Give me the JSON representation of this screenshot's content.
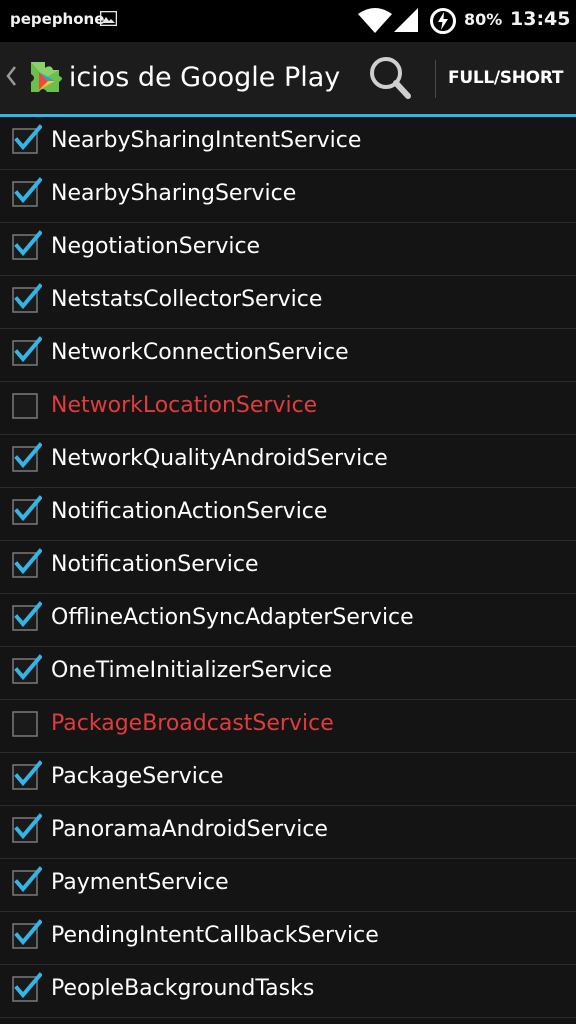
{
  "status_bar": {
    "carrier": "pepephone",
    "battery": "80%",
    "time": "13:45"
  },
  "action_bar": {
    "title": "Servicios de Google Play",
    "toggle_label": "FULL/SHORT"
  },
  "colors": {
    "accent": "#33b5e5",
    "disabled_text": "#e23b3b",
    "background": "#141414"
  },
  "services": [
    {
      "name": "NearbySharingIntentService",
      "enabled": true
    },
    {
      "name": "NearbySharingService",
      "enabled": true
    },
    {
      "name": "NegotiationService",
      "enabled": true
    },
    {
      "name": "NetstatsCollectorService",
      "enabled": true
    },
    {
      "name": "NetworkConnectionService",
      "enabled": true
    },
    {
      "name": "NetworkLocationService",
      "enabled": false
    },
    {
      "name": "NetworkQualityAndroidService",
      "enabled": true
    },
    {
      "name": "NotificationActionService",
      "enabled": true
    },
    {
      "name": "NotificationService",
      "enabled": true
    },
    {
      "name": "OfflineActionSyncAdapterService",
      "enabled": true
    },
    {
      "name": "OneTimeInitializerService",
      "enabled": true
    },
    {
      "name": "PackageBroadcastService",
      "enabled": false
    },
    {
      "name": "PackageService",
      "enabled": true
    },
    {
      "name": "PanoramaAndroidService",
      "enabled": true
    },
    {
      "name": "PaymentService",
      "enabled": true
    },
    {
      "name": "PendingIntentCallbackService",
      "enabled": true
    },
    {
      "name": "PeopleBackgroundTasks",
      "enabled": true
    },
    {
      "name": "",
      "enabled": true
    }
  ]
}
